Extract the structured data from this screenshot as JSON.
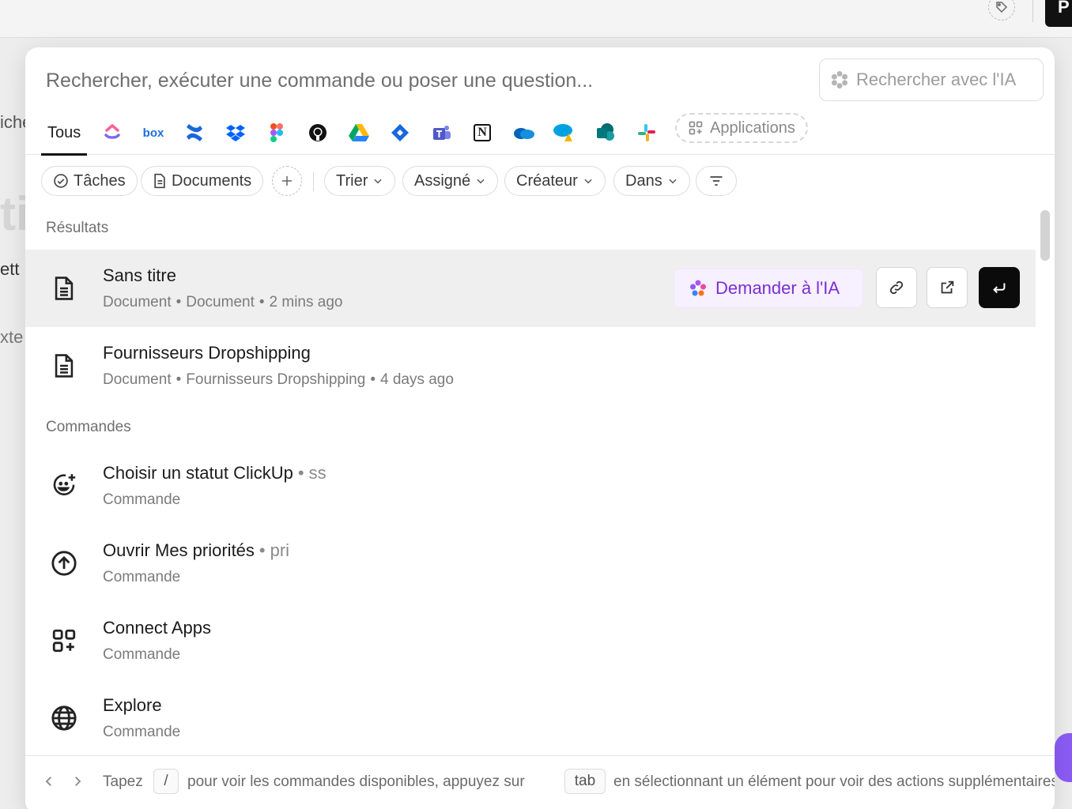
{
  "background": {
    "black_button_label": "P",
    "side_fragments": [
      "iche",
      "ett",
      "xte"
    ],
    "big_fragment": "ti"
  },
  "search": {
    "placeholder": "Rechercher, exécuter une commande ou poser une question...",
    "value": "",
    "ai_button_label": "Rechercher avec l'IA"
  },
  "tabs": {
    "all_label": "Tous",
    "apps": [
      "clickup-icon",
      "box-icon",
      "confluence-icon",
      "dropbox-icon",
      "figma-icon",
      "github-icon",
      "google-drive-icon",
      "jira-icon",
      "teams-icon",
      "notion-icon",
      "onedrive-icon",
      "salesforce-icon",
      "sharepoint-icon",
      "slack-icon"
    ],
    "box_text": "box",
    "notion_text": "N",
    "applications_label": "Applications"
  },
  "filters": {
    "tasks": "Tâches",
    "documents": "Documents",
    "sort": "Trier",
    "assigned": "Assigné",
    "creator": "Créateur",
    "in": "Dans"
  },
  "results": {
    "label": "Résultats",
    "items": [
      {
        "title": "Sans titre",
        "type": "Document",
        "location": "Document",
        "time": "2 mins ago"
      },
      {
        "title": "Fournisseurs Dropshipping",
        "type": "Document",
        "location": "Fournisseurs Dropshipping",
        "time": "4 days ago"
      }
    ],
    "ask_ai_label": "Demander à l'IA"
  },
  "commands": {
    "label": "Commandes",
    "items": [
      {
        "title": "Choisir un statut ClickUp",
        "hint": "ss",
        "sub": "Commande"
      },
      {
        "title": "Ouvrir Mes priorités",
        "hint": "pri",
        "sub": "Commande"
      },
      {
        "title": "Connect Apps",
        "hint": "",
        "sub": "Commande"
      },
      {
        "title": "Explore",
        "hint": "",
        "sub": "Commande"
      }
    ]
  },
  "footer": {
    "text1": "Tapez",
    "key1": "/",
    "text2": "pour voir les commandes disponibles, appuyez sur",
    "key2": "tab",
    "text3": "en sélectionnant un élément pour voir des actions supplémentaires"
  },
  "colors": {
    "accent_purple": "#7a2fd3",
    "ask_ai_bg": "#f6f0ff",
    "enter_button": "#0b0b0b"
  }
}
